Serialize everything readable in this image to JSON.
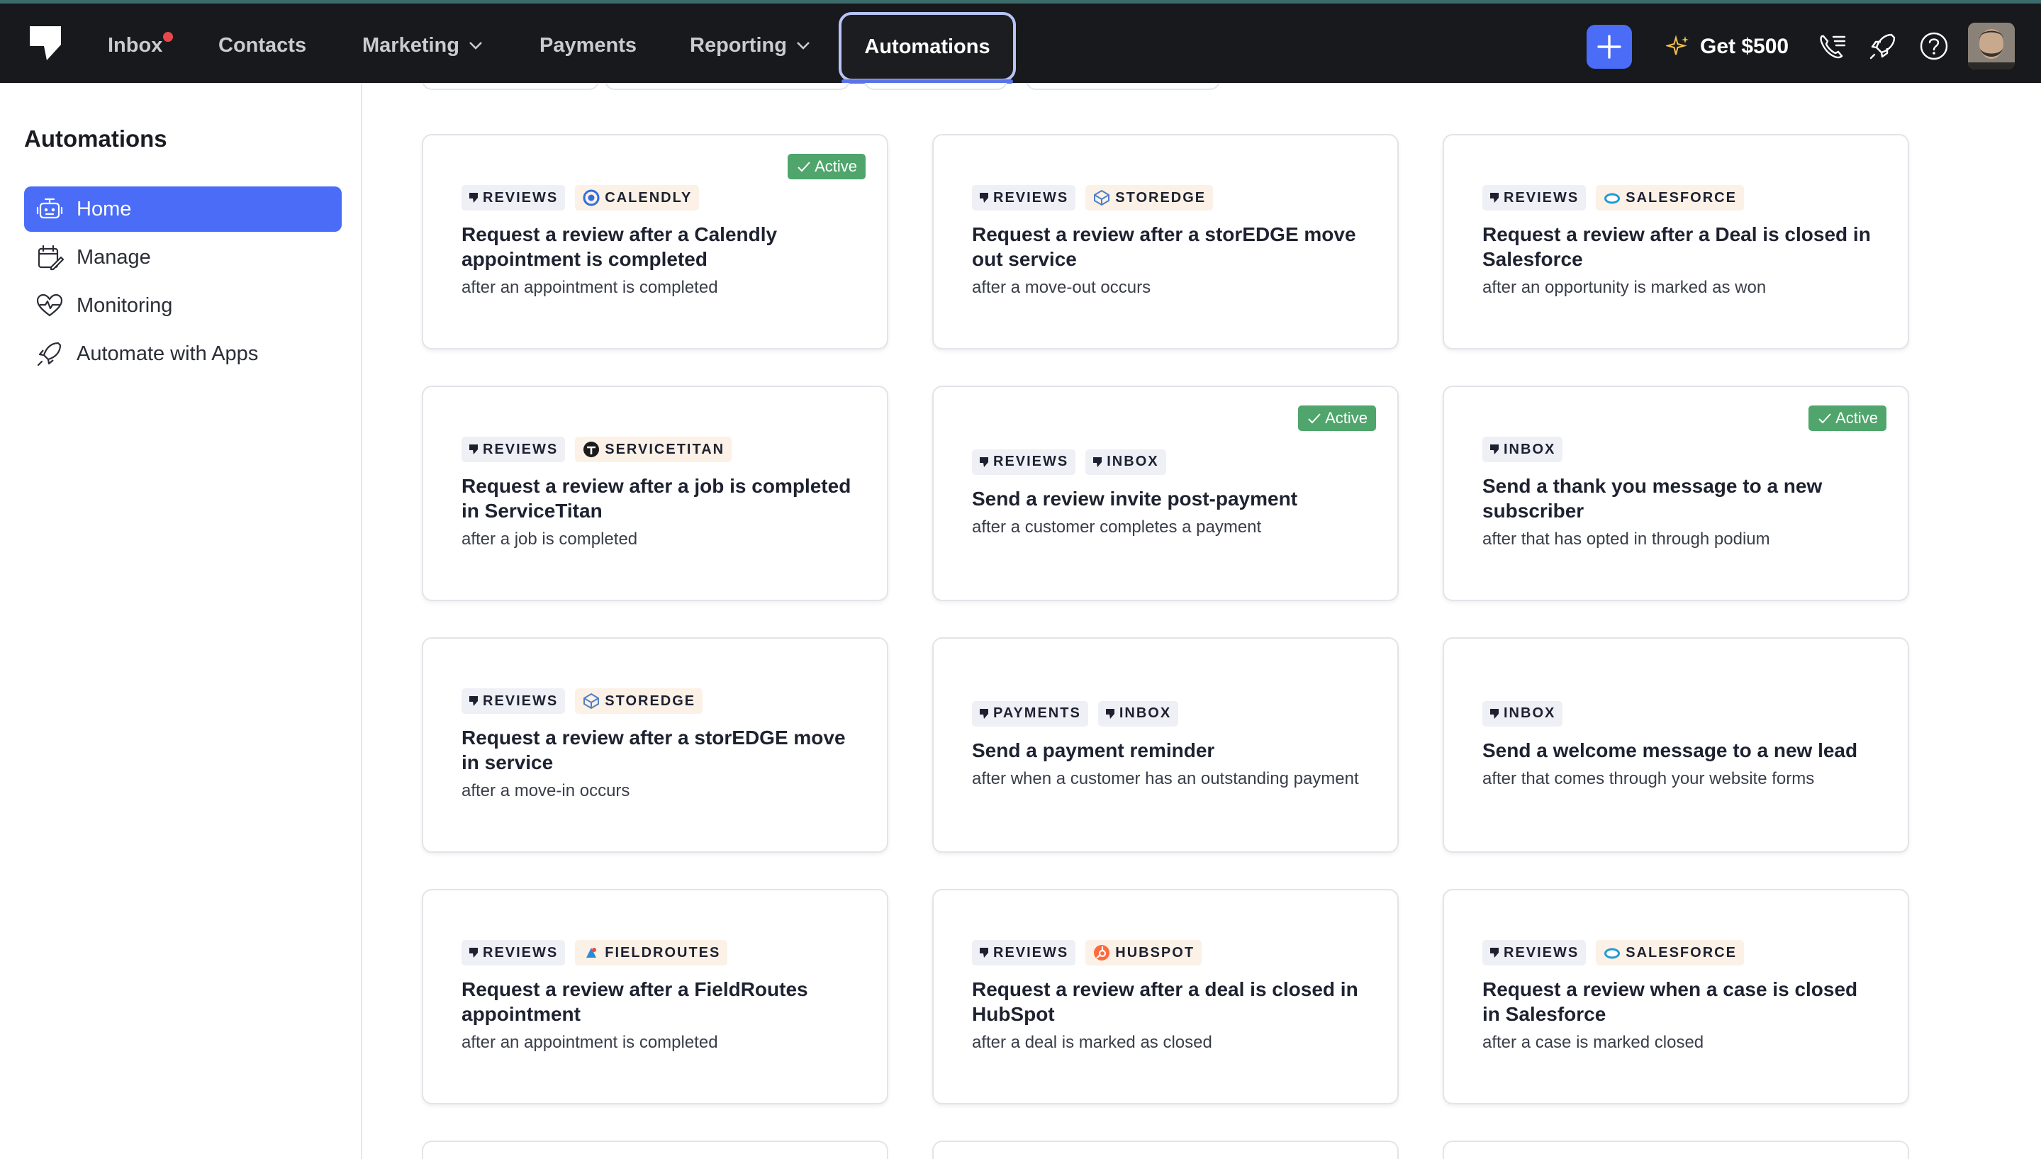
{
  "nav": {
    "items": [
      {
        "label": "Inbox",
        "has_dot": true
      },
      {
        "label": "Contacts"
      },
      {
        "label": "Marketing",
        "has_chevron": true
      },
      {
        "label": "Payments"
      },
      {
        "label": "Reporting",
        "has_chevron": true
      }
    ],
    "active": "Automations",
    "promo": "Get $500",
    "icons": [
      "plus-icon",
      "sparkle-icon",
      "phone-list-icon",
      "rocket-icon",
      "help-icon"
    ]
  },
  "sidebar": {
    "title": "Automations",
    "items": [
      {
        "label": "Home",
        "icon": "robot-icon",
        "active": true
      },
      {
        "label": "Manage",
        "icon": "calendar-edit-icon"
      },
      {
        "label": "Monitoring",
        "icon": "heart-pulse-icon"
      },
      {
        "label": "Automate with Apps",
        "icon": "rocket-icon"
      }
    ]
  },
  "cards": [
    {
      "tags": [
        {
          "label": "REVIEWS",
          "kind": "podium"
        },
        {
          "label": "CALENDLY",
          "kind": "calendly"
        }
      ],
      "title": "Request a review after a Calendly appointment is completed",
      "subtitle": "after an appointment is completed",
      "badge": "Active"
    },
    {
      "tags": [
        {
          "label": "REVIEWS",
          "kind": "podium"
        },
        {
          "label": "STOREDGE",
          "kind": "storedge"
        }
      ],
      "title": "Request a review after a storEDGE move out service",
      "subtitle": "after a move-out occurs",
      "badge": ""
    },
    {
      "tags": [
        {
          "label": "REVIEWS",
          "kind": "podium"
        },
        {
          "label": "SALESFORCE",
          "kind": "salesforce"
        }
      ],
      "title": "Request a review after a Deal is closed in Salesforce",
      "subtitle": "after an opportunity is marked as won",
      "badge": ""
    },
    {
      "tags": [
        {
          "label": "REVIEWS",
          "kind": "podium"
        },
        {
          "label": "SERVICETITAN",
          "kind": "servicetitan"
        }
      ],
      "title": "Request a review after a job is completed in ServiceTitan",
      "subtitle": "after a job is completed",
      "badge": ""
    },
    {
      "tags": [
        {
          "label": "REVIEWS",
          "kind": "podium"
        },
        {
          "label": "INBOX",
          "kind": "podium"
        }
      ],
      "title": "Send a review invite post-payment",
      "subtitle": "after a customer completes a payment",
      "badge": "Active"
    },
    {
      "tags": [
        {
          "label": "INBOX",
          "kind": "podium"
        }
      ],
      "title": "Send a thank you message to a new subscriber",
      "subtitle": "after that has opted in through podium",
      "badge": "Active"
    },
    {
      "tags": [
        {
          "label": "REVIEWS",
          "kind": "podium"
        },
        {
          "label": "STOREDGE",
          "kind": "storedge"
        }
      ],
      "title": "Request a review after a storEDGE move in service",
      "subtitle": "after a move-in occurs",
      "badge": ""
    },
    {
      "tags": [
        {
          "label": "PAYMENTS",
          "kind": "podium"
        },
        {
          "label": "INBOX",
          "kind": "podium"
        }
      ],
      "title": "Send a payment reminder",
      "subtitle": "after when a customer has an outstanding payment",
      "badge": ""
    },
    {
      "tags": [
        {
          "label": "INBOX",
          "kind": "podium"
        }
      ],
      "title": "Send a welcome message to a new lead",
      "subtitle": "after that comes through your website forms",
      "badge": ""
    },
    {
      "tags": [
        {
          "label": "REVIEWS",
          "kind": "podium"
        },
        {
          "label": "FIELDROUTES",
          "kind": "fieldroutes"
        }
      ],
      "title": "Request a review after a FieldRoutes appointment",
      "subtitle": "after an appointment is completed",
      "badge": ""
    },
    {
      "tags": [
        {
          "label": "REVIEWS",
          "kind": "podium"
        },
        {
          "label": "HUBSPOT",
          "kind": "hubspot"
        }
      ],
      "title": "Request a review after a deal is closed in HubSpot",
      "subtitle": "after a deal is marked as closed",
      "badge": ""
    },
    {
      "tags": [
        {
          "label": "REVIEWS",
          "kind": "podium"
        },
        {
          "label": "SALESFORCE",
          "kind": "salesforce"
        }
      ],
      "title": "Request a review when a case is closed in Salesforce",
      "subtitle": "after a case is marked closed",
      "badge": ""
    }
  ],
  "colors": {
    "accent": "#4a6cf7",
    "active_badge": "#4fa56b",
    "nav_bg": "#18191c"
  }
}
